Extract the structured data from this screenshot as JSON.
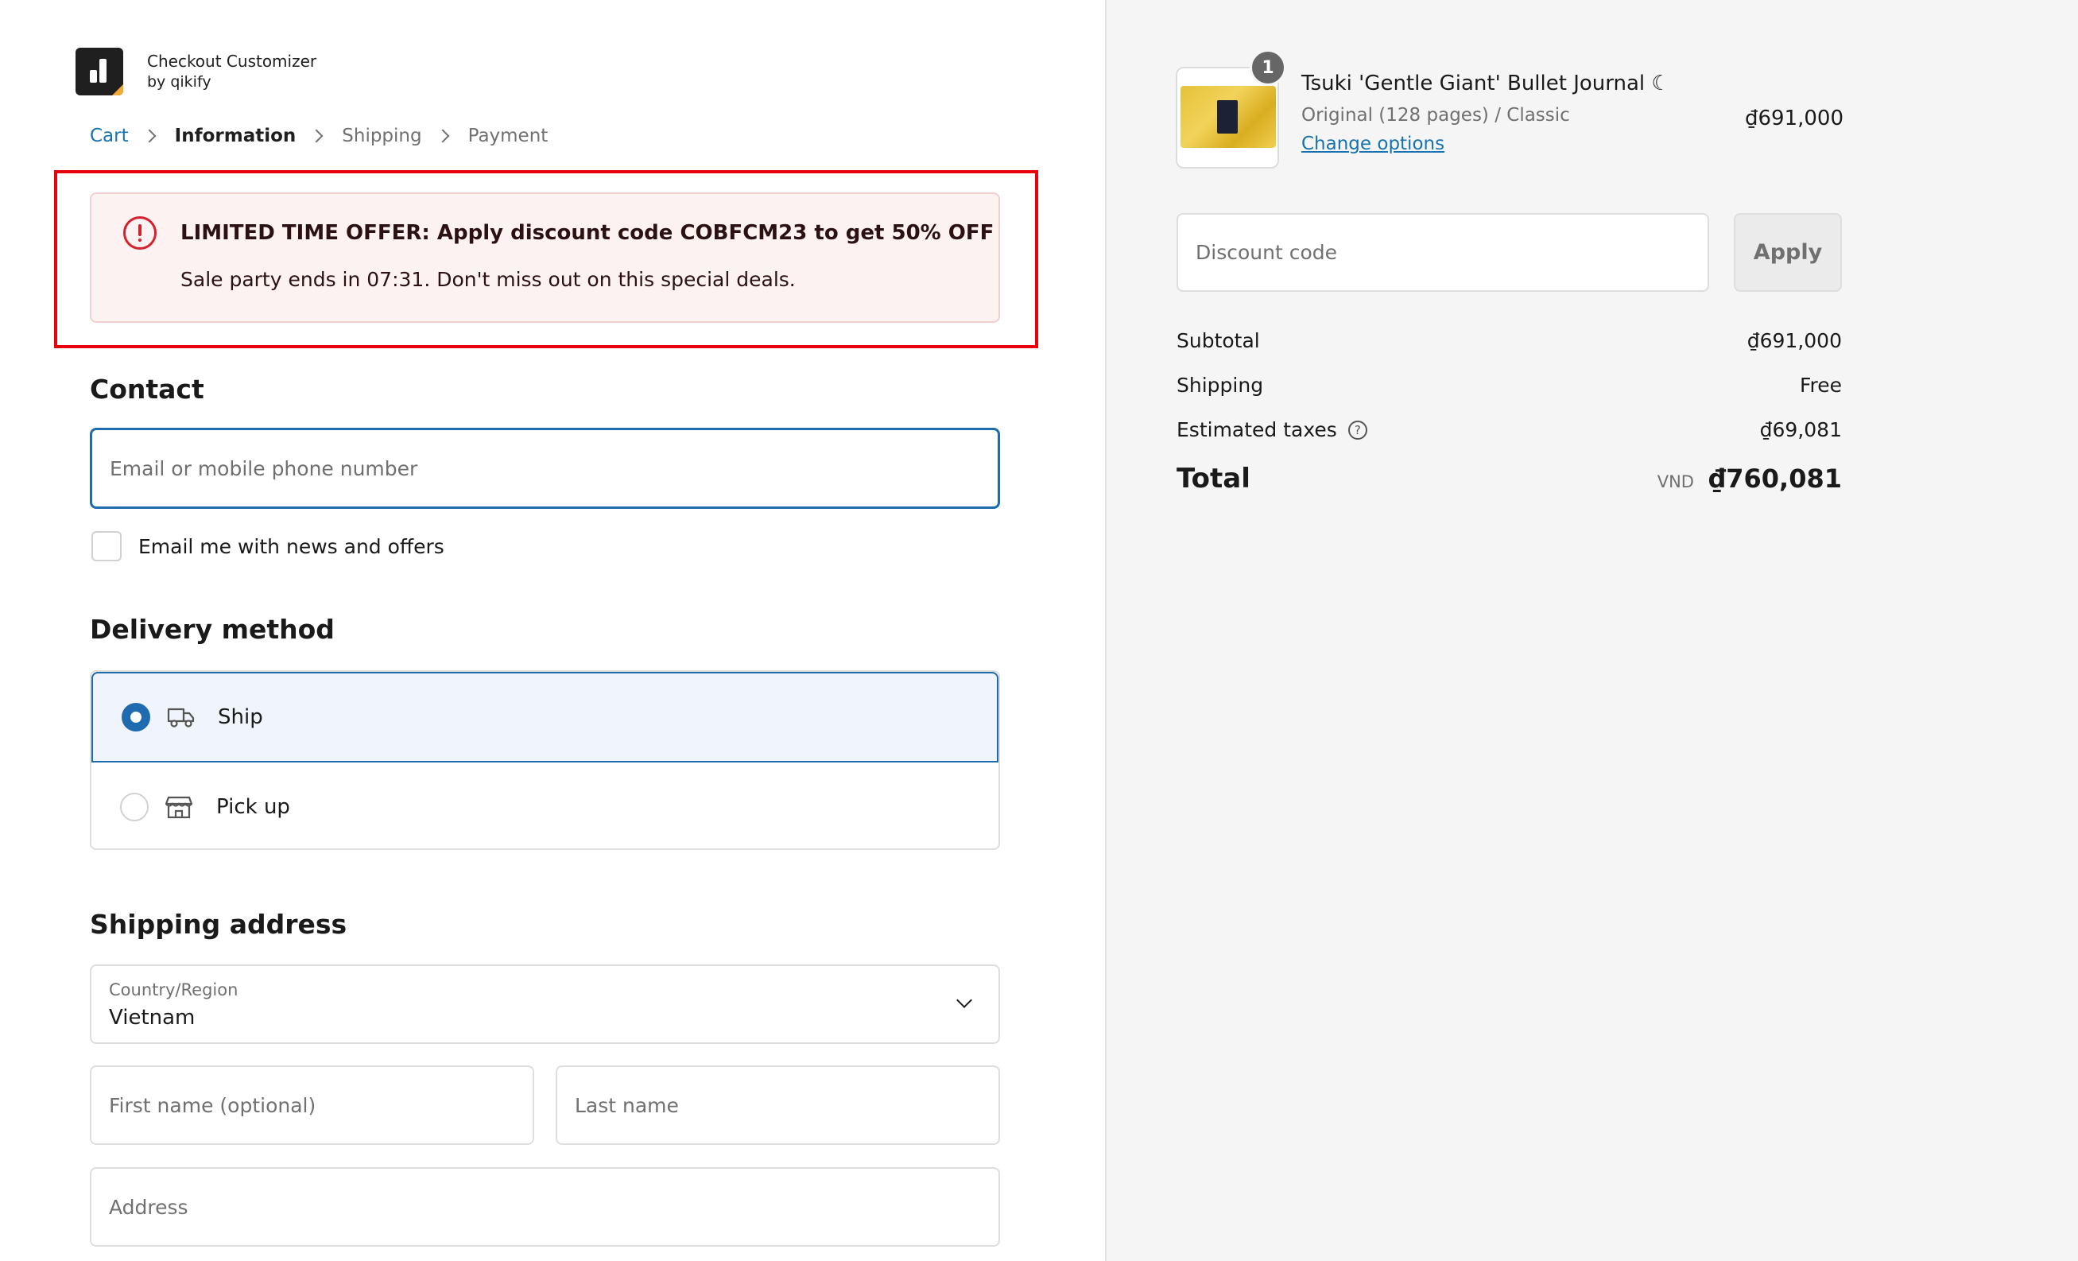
{
  "brand": {
    "name": "Checkout Customizer",
    "by": "by qikify"
  },
  "breadcrumb": {
    "cart": "Cart",
    "information": "Information",
    "shipping": "Shipping",
    "payment": "Payment"
  },
  "offer": {
    "title": "LIMITED TIME OFFER: Apply discount code COBFCM23 to get 50% OFF",
    "subtitle": "Sale party ends in 07:31. Don't miss out on this special deals."
  },
  "contact": {
    "heading": "Contact",
    "email_placeholder": "Email or mobile phone number",
    "news_label": "Email me with news and offers"
  },
  "delivery": {
    "heading": "Delivery method",
    "options": [
      {
        "label": "Ship",
        "selected": true,
        "icon": "truck-icon"
      },
      {
        "label": "Pick up",
        "selected": false,
        "icon": "store-icon"
      }
    ]
  },
  "shipping_address": {
    "heading": "Shipping address",
    "country_label": "Country/Region",
    "country_value": "Vietnam",
    "first_name_placeholder": "First name (optional)",
    "last_name_placeholder": "Last name",
    "address_placeholder": "Address"
  },
  "order": {
    "product": {
      "quantity": "1",
      "name": "Tsuki 'Gentle Giant' Bullet Journal ☾",
      "variant": "Original (128 pages) / Classic",
      "change_link": "Change options",
      "price": "₫691,000"
    },
    "discount_placeholder": "Discount code",
    "apply_label": "Apply",
    "subtotal_label": "Subtotal",
    "subtotal_value": "₫691,000",
    "shipping_label": "Shipping",
    "shipping_value": "Free",
    "taxes_label": "Estimated taxes",
    "taxes_value": "₫69,081",
    "total_label": "Total",
    "currency": "VND",
    "total_value": "₫760,081"
  },
  "colors": {
    "accent": "#1f6bb0",
    "link": "#1773b0",
    "alert_red": "#d4212b",
    "highlight_red": "#e8000b"
  }
}
